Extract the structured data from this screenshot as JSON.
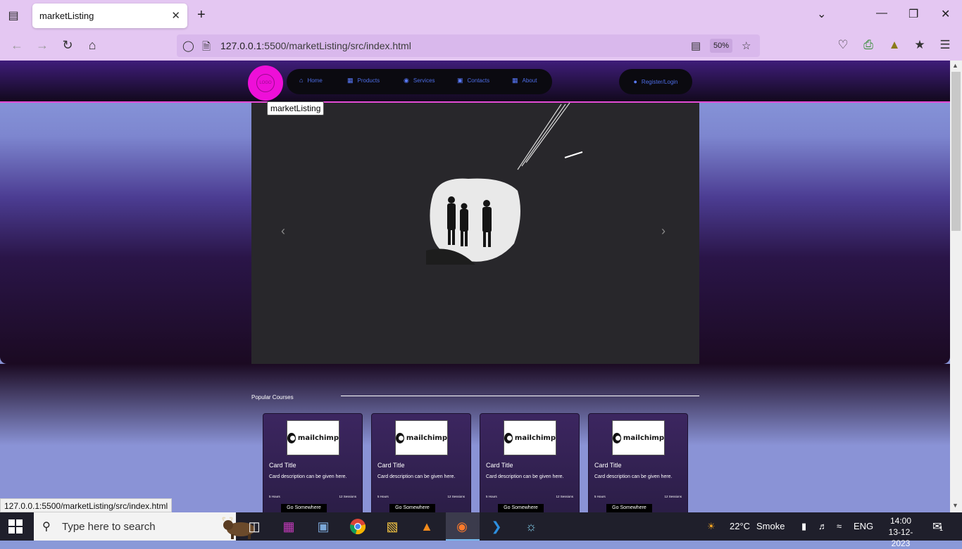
{
  "browser": {
    "tab_title": "marketListing",
    "url_host": "127.0.0.1",
    "url_rest": ":5500/marketListing/src/index.html",
    "zoom": "50%",
    "status_url": "127.0.0.1:5500/marketListing/src/index.html"
  },
  "site": {
    "logo_text": "LOGO",
    "nav": [
      {
        "label": "Home",
        "icon": "home-icon"
      },
      {
        "label": "Products",
        "icon": "products-icon"
      },
      {
        "label": "Services",
        "icon": "services-icon"
      },
      {
        "label": "Contacts",
        "icon": "contacts-icon"
      },
      {
        "label": "About",
        "icon": "about-icon"
      }
    ],
    "login_label": "Register/Login",
    "tooltip": "marketListing"
  },
  "section": {
    "title": "Popular Courses"
  },
  "cards": [
    {
      "brand": "mailchimp",
      "title": "Card Title",
      "desc": "Card description can be given here.",
      "hours": "5 Hours",
      "sessions": "12 Sessions",
      "button": "Go Somewhere"
    },
    {
      "brand": "mailchimp",
      "title": "Card Title",
      "desc": "Card description can be given here.",
      "hours": "5 Hours",
      "sessions": "12 Sessions",
      "button": "Go Somewhere"
    },
    {
      "brand": "mailchimp",
      "title": "Card Title",
      "desc": "Card description can be given here.",
      "hours": "5 Hours",
      "sessions": "12 Sessions",
      "button": "Go Somewhere"
    },
    {
      "brand": "mailchimp",
      "title": "Card Title",
      "desc": "Card description can be given here.",
      "hours": "5 Hours",
      "sessions": "12 Sessions",
      "button": "Go Somewhere"
    }
  ],
  "taskbar": {
    "search_placeholder": "Type here to search",
    "weather": "22°C",
    "weather_desc": "Smoke",
    "language": "ENG",
    "time": "14:00",
    "date": "13-12-2023",
    "notifications": "1"
  },
  "colors": {
    "chrome": "#e4c7f2",
    "logo": "#ee0fd8",
    "nav_text": "#4d6de6"
  }
}
